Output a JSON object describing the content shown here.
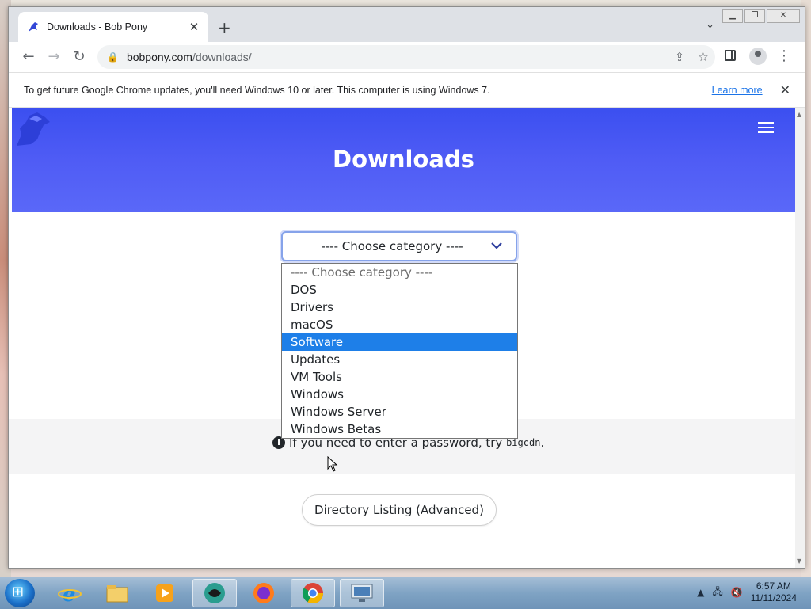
{
  "browser": {
    "tab_title": "Downloads - Bob Pony",
    "new_tab_icon": "plus-icon",
    "url_domain": "bobpony.com",
    "url_path": "/downloads/",
    "info_message": "To get future Google Chrome updates, you'll need Windows 10 or later. This computer is using Windows 7.",
    "learn_more": "Learn more",
    "window_controls": [
      "minimize",
      "restore",
      "close"
    ]
  },
  "page": {
    "heading": "Downloads",
    "select": {
      "value": "---- Choose category ----",
      "options": [
        "---- Choose category ----",
        "DOS",
        "Drivers",
        "macOS",
        "Software",
        "Updates",
        "VM Tools",
        "Windows",
        "Windows Server",
        "Windows Betas"
      ],
      "highlighted": "Software"
    },
    "notice_text": "If you need to enter a password, try",
    "notice_code": "bigcdn",
    "notice_end": ".",
    "directory_button": "Directory Listing (Advanced)",
    "brand_color": "#4451f2",
    "highlight_color": "#1e7fe8"
  },
  "taskbar": {
    "apps": [
      "internet-explorer-icon",
      "file-explorer-icon",
      "media-player-icon",
      "unknown-app-icon",
      "firefox-icon",
      "chrome-icon",
      "remote-desktop-icon"
    ],
    "time": "6:57 AM",
    "date": "11/11/2024"
  }
}
